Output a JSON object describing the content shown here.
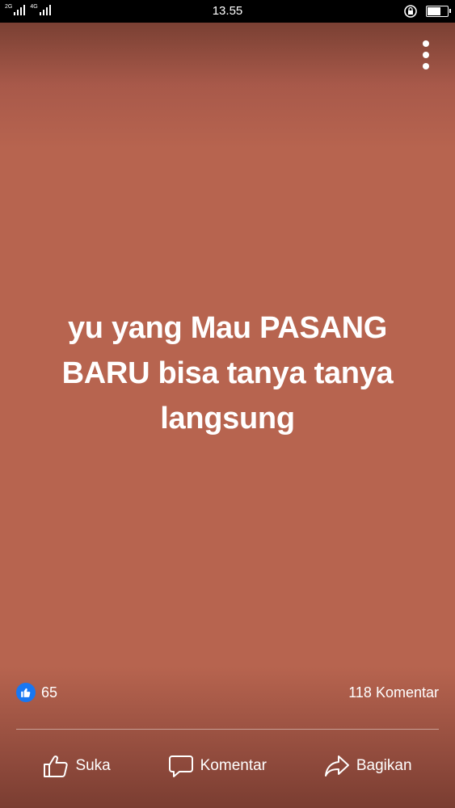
{
  "status_bar": {
    "network_1": "2G",
    "network_2": "4G",
    "time": "13.55"
  },
  "post": {
    "text": "yu yang Mau PASANG BARU bisa tanya tanya langsung",
    "background_color": "#b7644f"
  },
  "reactions": {
    "like_count": "65",
    "comment_count": "118 Komentar"
  },
  "actions": {
    "like_label": "Suka",
    "comment_label": "Komentar",
    "share_label": "Bagikan"
  },
  "icons": [
    "signal-icon",
    "rotation-lock-icon",
    "battery-icon",
    "more-vertical-icon",
    "like-reaction-icon",
    "thumbs-up-icon",
    "comment-bubble-icon",
    "share-arrow-icon"
  ],
  "colors": {
    "like_blue": "#1877f2",
    "text": "#ffffff"
  }
}
